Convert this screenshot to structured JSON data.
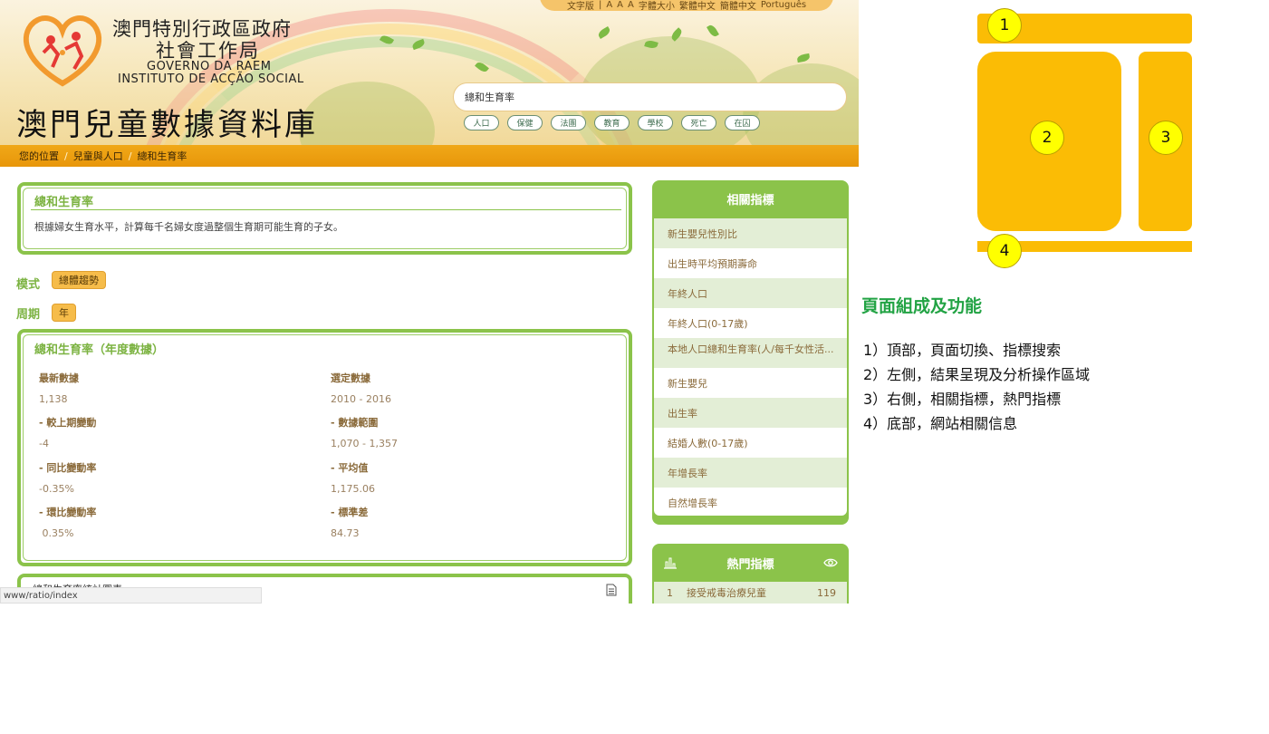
{
  "header": {
    "org_name_zh_line1": "澳門特別行政區政府",
    "org_name_zh_line2": "社會工作局",
    "org_name_pt_line1": "GOVERNO DA RAEM",
    "org_name_pt_line2": "INSTITUTO DE ACÇÃO SOCIAL",
    "site_title": "澳門兒童數據資料庫",
    "lang_bar": [
      "文字版",
      "|",
      "A",
      "A",
      "A",
      "字體大小",
      "繁體中文",
      "簡體中文",
      "Português"
    ],
    "search_value": "總和生育率",
    "quick_tags": [
      "人口",
      "保健",
      "法團",
      "教育",
      "學校",
      "死亡",
      "在囚"
    ]
  },
  "breadcrumb": {
    "items": [
      "您的位置",
      "兒童與人口",
      "總和生育率"
    ],
    "separator": "/"
  },
  "main": {
    "description_card": {
      "title": "總和生育率",
      "text": "根據婦女生育水平，計算每千名婦女度過整個生育期可能生育的子女。"
    },
    "filters": [
      {
        "label": "模式",
        "chip": "總體趨勢"
      },
      {
        "label": "周期",
        "chip": "年"
      }
    ],
    "stats_card": {
      "title": "總和生育率（年度數據）",
      "left": [
        {
          "label": "最新數據",
          "value": "1,138"
        },
        {
          "label": "- 較上期變動",
          "value": "-4"
        },
        {
          "label": "- 同比變動率",
          "value": "-0.35%"
        },
        {
          "label": "- 環比變動率",
          "value": " 0.35%"
        }
      ],
      "right": [
        {
          "label": "選定數據",
          "value": "2010 - 2016"
        },
        {
          "label": "- 數據範圍",
          "value": "1,070 - 1,357"
        },
        {
          "label": "- 平均值",
          "value": "1,175.06"
        },
        {
          "label": "- 標準差",
          "value": "84.73"
        }
      ]
    },
    "bottom_card_title": "總和生育率統計圖表",
    "status_url": "www/ratio/index"
  },
  "sidebar": {
    "related": {
      "title": "相關指標",
      "items": [
        "新生嬰兒性別比",
        "出生時平均預期壽命",
        "年終人口",
        "年終人口(0-17歲)",
        "本地人口總和生育率(人/每千女性活...",
        "新生嬰兒",
        "出生率",
        "結婚人數(0-17歲)",
        "年增長率",
        "自然增長率"
      ]
    },
    "hot": {
      "title": "熱門指標",
      "first_item": {
        "rank": "1",
        "name": "接受戒毒治療兒童",
        "count": "119"
      }
    }
  },
  "annotation": {
    "badges": [
      "1",
      "2",
      "3",
      "4"
    ],
    "colors": {
      "block": "#fbbc05",
      "badge": "#ffff00",
      "title": "#22a344"
    },
    "legend_title": "頁面組成及功能",
    "legend_lines": [
      "1）頂部，頁面切換、指標搜索",
      "2）左側，結果呈現及分析操作區域",
      "3）右側，相關指標，熱門指標",
      "4）底部，網站相關信息"
    ]
  }
}
